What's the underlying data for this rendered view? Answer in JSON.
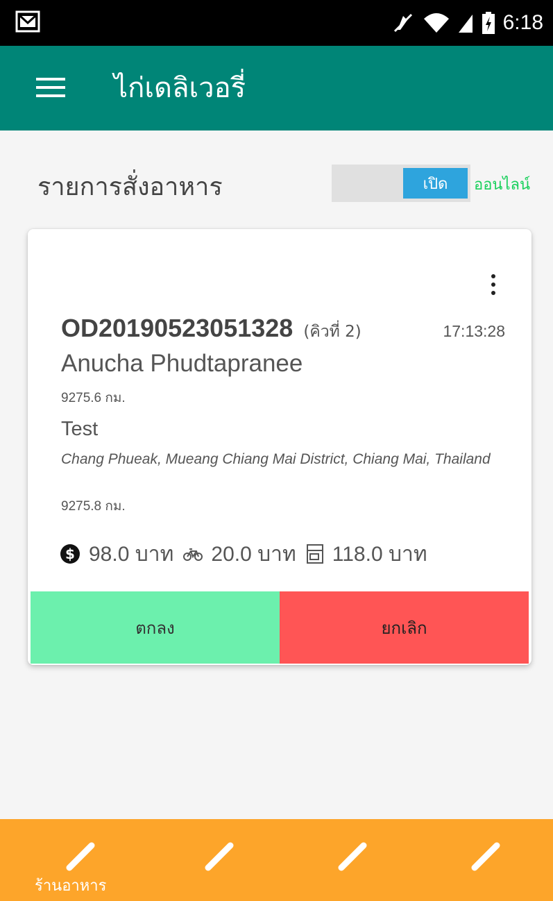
{
  "status_bar": {
    "time": "6:18",
    "icons": [
      "gmail-icon",
      "mute-icon",
      "wifi-icon",
      "signal-icon",
      "battery-charging-icon"
    ]
  },
  "toolbar": {
    "title": "ไก่เดลิเวอรี่",
    "menu_icon": "hamburger-menu-icon"
  },
  "orders_header": {
    "title": "รายการสั่งอาหาร",
    "toggle_label": "เปิด",
    "toggle_state": "on",
    "status_label": "ออนไลน์"
  },
  "order_card": {
    "order_id": "OD20190523051328",
    "queue": "(คิวที่ 2)",
    "time": "17:13:28",
    "customer_name": "Anucha Phudtapranee",
    "customer_distance": "9275.6 กม.",
    "shop_name": "Test",
    "shop_address": "Chang Phueak, Mueang Chiang Mai District, Chiang Mai, Thailand",
    "shop_distance": "9275.8 กม.",
    "food_price": "98.0 บาท",
    "delivery_fee": "20.0 บาท",
    "total": "118.0 บาท",
    "accept_label": "ตกลง",
    "cancel_label": "ยกเลิก"
  },
  "bottom_nav": {
    "items": [
      {
        "label": "ร้านอาหาร",
        "icon": "pencil-icon"
      },
      {
        "label": "",
        "icon": "pencil-icon"
      },
      {
        "label": "",
        "icon": "pencil-icon"
      },
      {
        "label": "",
        "icon": "pencil-icon"
      }
    ]
  },
  "colors": {
    "toolbar": "#008577",
    "toggle_on": "#2ea4dd",
    "online": "#19d05c",
    "accept": "#6cf0ad",
    "cancel": "#ff5555",
    "bottom_nav": "#fda52a"
  }
}
